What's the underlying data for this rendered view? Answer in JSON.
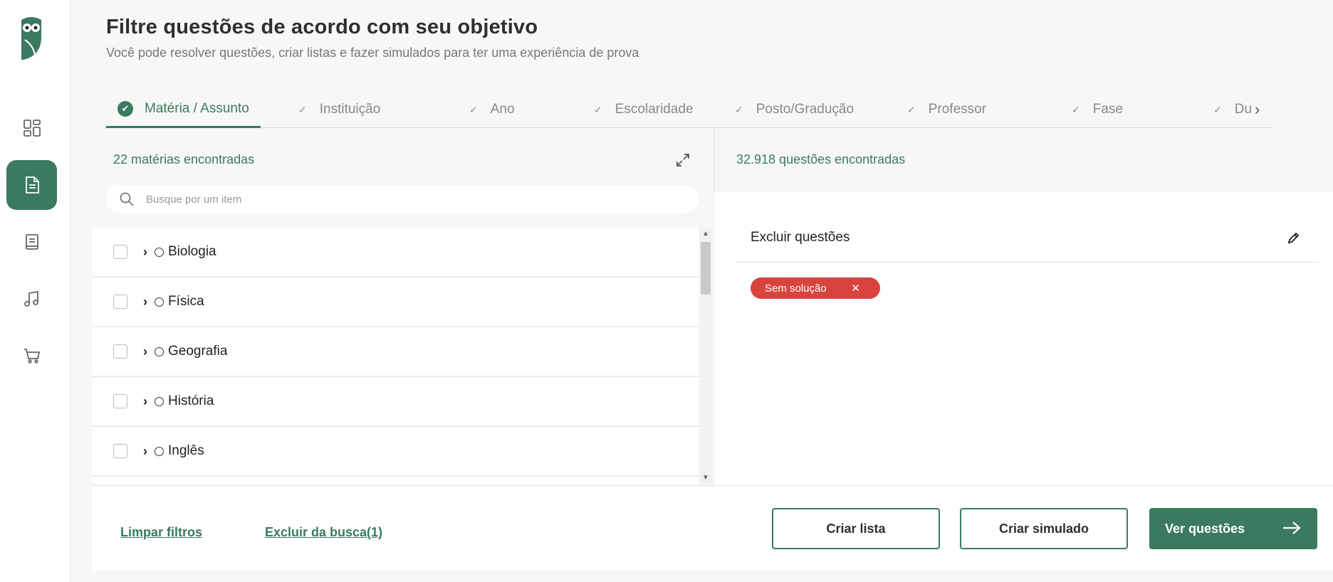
{
  "header": {
    "title": "Filtre questões de acordo com seu objetivo",
    "subtitle": "Você pode resolver questões, criar listas e fazer simulados para ter uma experiência de prova"
  },
  "sidebar": {
    "items": [
      {
        "name": "dashboard",
        "icon": "dashboard-icon"
      },
      {
        "name": "questoes",
        "icon": "document-icon",
        "active": true
      },
      {
        "name": "cadernos",
        "icon": "book-icon"
      },
      {
        "name": "musica",
        "icon": "music-icon"
      },
      {
        "name": "loja",
        "icon": "cart-icon"
      }
    ]
  },
  "tabs": [
    {
      "label": "Matéria / Assunto",
      "active": true
    },
    {
      "label": "Instituição"
    },
    {
      "label": "Ano"
    },
    {
      "label": "Escolaridade"
    },
    {
      "label": "Posto/Gradução"
    },
    {
      "label": "Professor"
    },
    {
      "label": "Fase"
    },
    {
      "label": "Du"
    }
  ],
  "left": {
    "count": "22 matérias encontradas",
    "search_placeholder": "Busque por um item",
    "items": [
      {
        "label": "Biologia"
      },
      {
        "label": "Física"
      },
      {
        "label": "Geografia"
      },
      {
        "label": "História"
      },
      {
        "label": "Inglês"
      }
    ]
  },
  "right": {
    "count": "32.918 questões encontradas",
    "section_title": "Excluir questões",
    "chip_label": "Sem solução",
    "chip_remove": "✕"
  },
  "bottom": {
    "clear_label": "Limpar filtros",
    "exclude_label": "Excluir da busca(1)",
    "create_list_label": "Criar lista",
    "create_sim_label": "Criar simulado",
    "see_label": "Ver questões"
  },
  "colors": {
    "accent": "#3b7a5e",
    "chip": "#d9433d"
  }
}
